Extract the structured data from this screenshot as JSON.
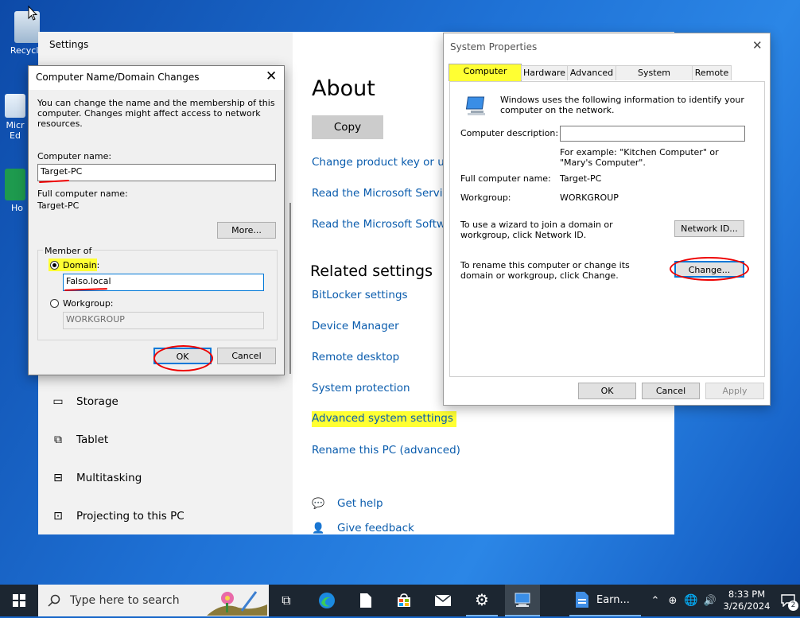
{
  "desktop": {
    "icons": [
      {
        "label": "Recycle"
      },
      {
        "label": "Micr Ed"
      },
      {
        "label": "Ho"
      }
    ]
  },
  "settings": {
    "title": "Settings",
    "nav": [
      {
        "label": "Storage",
        "icon": "storage-icon"
      },
      {
        "label": "Tablet",
        "icon": "tablet-icon"
      },
      {
        "label": "Multitasking",
        "icon": "multitasking-icon"
      },
      {
        "label": "Projecting to this PC",
        "icon": "projecting-icon"
      }
    ],
    "about_heading": "About",
    "copy_label": "Copy",
    "links": [
      "Change product key or upg",
      "Read the Microsoft Service",
      "Read the Microsoft Softwa"
    ],
    "related_heading": "Related settings",
    "related_links": [
      "BitLocker settings",
      "Device Manager",
      "Remote desktop",
      "System protection",
      "Advanced system settings",
      "Rename this PC (advanced)"
    ],
    "help": "Get help",
    "feedback": "Give feedback"
  },
  "domain_dialog": {
    "title": "Computer Name/Domain Changes",
    "description": "You can change the name and the membership of this computer. Changes might affect access to network resources.",
    "computer_name_label": "Computer name:",
    "computer_name_value": "Target-PC",
    "full_name_label": "Full computer name:",
    "full_name_value": "Target-PC",
    "more_label": "More...",
    "member_of_label": "Member of",
    "domain_label": "Domain:",
    "domain_value": "Falso.local",
    "workgroup_label": "Workgroup:",
    "workgroup_value": "WORKGROUP",
    "ok_label": "OK",
    "cancel_label": "Cancel"
  },
  "system_properties": {
    "title": "System Properties",
    "tabs": [
      "Computer Name",
      "Hardware",
      "Advanced",
      "System Protection",
      "Remote"
    ],
    "info_text": "Windows uses the following information to identify your computer on the network.",
    "description_label": "Computer description:",
    "description_value": "",
    "example_text": "For example: \"Kitchen Computer\" or \"Mary's Computer\".",
    "full_name_label": "Full computer name:",
    "full_name_value": "Target-PC",
    "workgroup_label": "Workgroup:",
    "workgroup_value": "WORKGROUP",
    "wizard_text": "To use a wizard to join a domain or workgroup, click Network ID.",
    "network_id_label": "Network ID...",
    "rename_text": "To rename this computer or change its domain or workgroup, click Change.",
    "change_label": "Change...",
    "ok_label": "OK",
    "cancel_label": "Cancel",
    "apply_label": "Apply"
  },
  "taskbar": {
    "search_placeholder": "Type here to search",
    "app_label": "Earn...",
    "time": "8:33 PM",
    "date": "3/26/2024",
    "notification_count": "2"
  },
  "colors": {
    "link": "#0a5cad",
    "highlight": "#ffff33",
    "annotation": "#ee0000",
    "focus_blue": "#0078d7"
  }
}
